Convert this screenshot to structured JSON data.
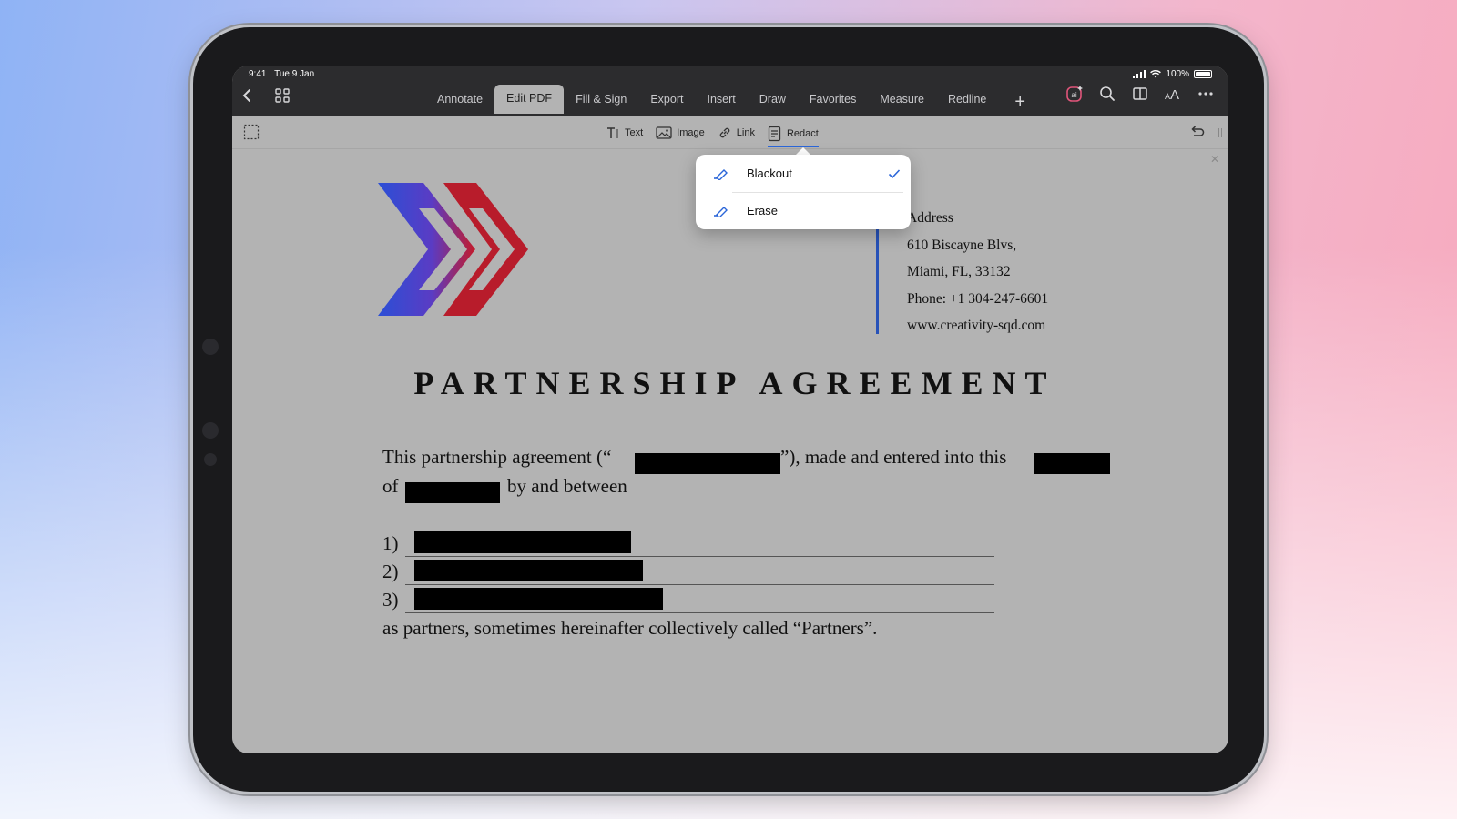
{
  "status": {
    "time": "9:41",
    "date": "Tue 9 Jan",
    "battery": "100%"
  },
  "tabs": [
    "Annotate",
    "Edit PDF",
    "Fill & Sign",
    "Export",
    "Insert",
    "Draw",
    "Favorites",
    "Measure",
    "Redline"
  ],
  "active_tab": "Edit PDF",
  "tools": {
    "text": "Text",
    "image": "Image",
    "link": "Link",
    "redact": "Redact"
  },
  "redact_menu": {
    "items": [
      {
        "label": "Blackout",
        "checked": true
      },
      {
        "label": "Erase",
        "checked": false
      }
    ]
  },
  "document": {
    "address": [
      "Address",
      "610 Biscayne Blvs,",
      "Miami, FL, 33132",
      "Phone: +1 304-247-6601",
      "www.creativity-sqd.com"
    ],
    "title": "PARTNERSHIP AGREEMENT",
    "para1_a": "This partnership agreement (“",
    "para1_b": "”), made and entered into this",
    "para2_a": "of",
    "para2_b": "by and between",
    "list_labels": [
      "1)",
      "2)",
      "3)"
    ],
    "closing": "as partners, sometimes hereinafter collectively called “Partners”."
  },
  "colors": {
    "accent": "#2b66d9",
    "address_bar": "#2752b8",
    "toolbar_bg": "#2c2c2e",
    "page_bg": "#b3b3b3"
  },
  "icons": [
    "back-icon",
    "grid-icon",
    "plus-icon",
    "ai-icon",
    "search-icon",
    "book-icon",
    "text-size-icon",
    "more-icon",
    "select-area-icon",
    "text-tool-icon",
    "image-tool-icon",
    "link-tool-icon",
    "redact-tool-icon",
    "undo-icon",
    "marker-icon",
    "checkmark-icon"
  ]
}
